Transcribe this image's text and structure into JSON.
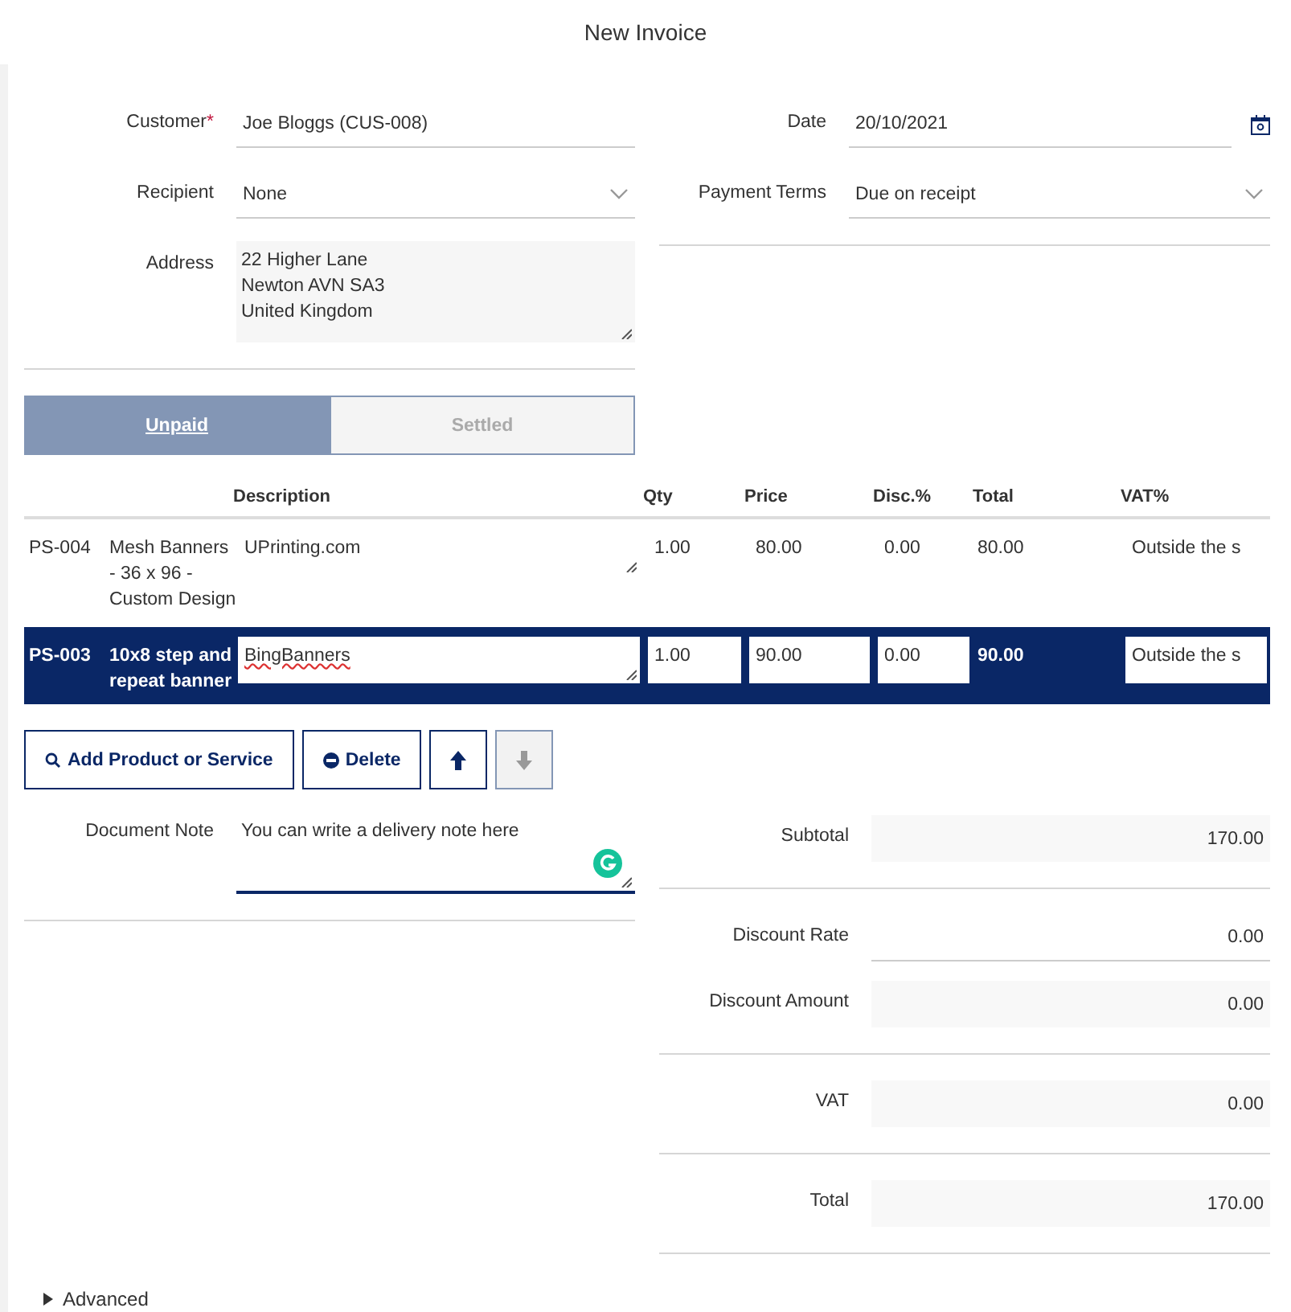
{
  "title": "New Invoice",
  "left_fields": [
    {
      "label": "Customer",
      "required_mark": "*",
      "kind": "text",
      "value": "Joe Bloggs (CUS-008)"
    },
    {
      "label": "Recipient",
      "kind": "select",
      "value": "None"
    },
    {
      "label": "Address",
      "kind": "area",
      "lines": [
        "22 Higher Lane",
        "Newton AVN SA3",
        "United Kingdom"
      ]
    }
  ],
  "right_fields": [
    {
      "label": "Date",
      "kind": "date",
      "value": "20/10/2021"
    },
    {
      "label": "Payment Terms",
      "kind": "select",
      "value": "Due on receipt"
    }
  ],
  "tabs": [
    {
      "label": "Unpaid",
      "selected": true
    },
    {
      "label": "Settled",
      "selected": false
    }
  ],
  "table": {
    "columns": [
      "Description",
      "Qty",
      "Price",
      "Disc.%",
      "Total",
      "VAT%"
    ],
    "rows": [
      {
        "code": "PS-004",
        "name": "Mesh Banners - 36 x 96 - Custom Design",
        "description": "UPrinting.com",
        "qty": "1.00",
        "price": "80.00",
        "disc": "0.00",
        "total": "80.00",
        "vat": "Outside the s",
        "selected": false
      },
      {
        "code": "PS-003",
        "name": "10x8 step and repeat banner",
        "description": "BingBanners",
        "qty": "1.00",
        "price": "90.00",
        "disc": "0.00",
        "total": "90.00",
        "vat": "Outside the s",
        "selected": true
      }
    ]
  },
  "buttons": [
    {
      "kind": "search",
      "label": "Add Product or Service",
      "disabled": false
    },
    {
      "kind": "delete",
      "label": "Delete",
      "disabled": false
    },
    {
      "kind": "up",
      "disabled": false
    },
    {
      "kind": "down",
      "disabled": true
    }
  ],
  "note": {
    "label": "Document Note",
    "value": "You can write a delivery note here"
  },
  "totals": [
    {
      "label": "Subtotal",
      "value": "170.00",
      "kind": "shaded",
      "divider": true
    },
    {
      "label": "Discount Rate",
      "value": "0.00",
      "kind": "underlined",
      "divider": false
    },
    {
      "label": "Discount Amount",
      "value": "0.00",
      "kind": "shaded",
      "divider": true
    },
    {
      "label": "VAT",
      "value": "0.00",
      "kind": "shaded",
      "divider": true
    },
    {
      "label": "Total",
      "value": "170.00",
      "kind": "shaded",
      "divider": true
    }
  ],
  "advanced": {
    "label": "Advanced"
  }
}
